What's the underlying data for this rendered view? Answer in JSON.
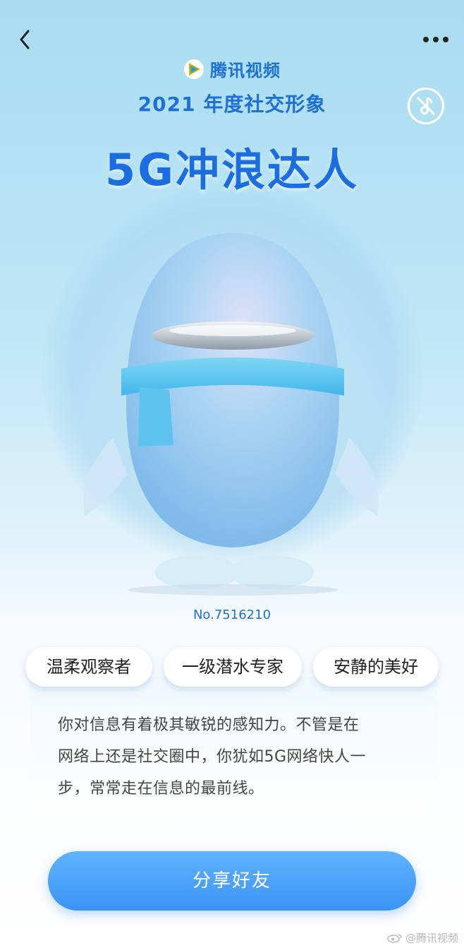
{
  "brand": {
    "name": "腾讯视频",
    "logo_icon": "tencent-video-logo"
  },
  "header": {
    "subtitle": "2021 年度社交形象",
    "title": "5G冲浪达人",
    "back_icon": "chevron-left-icon",
    "more_icon": "more-dots-icon",
    "mute_icon": "music-off-icon"
  },
  "profile": {
    "serial": "No.7516210",
    "tags": [
      "温柔观察者",
      "一级潜水专家",
      "安静的美好"
    ],
    "description_lines": [
      "你对信息有着极其敏锐的感知力。不管是在",
      "网络上还是社交圈中，你犹如5G网络快人一",
      "步，常常走在信息的最前线。"
    ]
  },
  "actions": {
    "share_label": "分享好友"
  },
  "watermark": {
    "text": "@腾讯视频"
  },
  "colors": {
    "title_blue": "#1c6ee0",
    "button_blue": "#3d93f5",
    "background_top": "#a9dcf1"
  }
}
